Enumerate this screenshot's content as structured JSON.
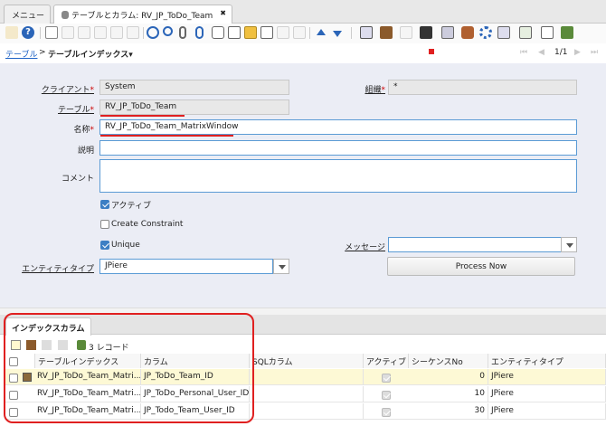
{
  "tabs": {
    "menu": "メニュー",
    "window": "テーブルとカラム: RV_JP_ToDo_Team",
    "close": "✖"
  },
  "breadcrumb": {
    "parent": "テーブル",
    "sep": ">",
    "current": "テーブルインデックス▾"
  },
  "nav": {
    "first": "⏮",
    "prev": "◀",
    "record": "1/1",
    "next": "▶",
    "last": "⏭"
  },
  "form": {
    "client_label": "クライアント",
    "client_value": "System",
    "org_label": "組織",
    "org_value": "*",
    "table_label": "テーブル",
    "table_value": "RV_JP_ToDo_Team",
    "name_label": "名称",
    "name_value": "RV_JP_ToDo_Team_MatrixWindow",
    "desc_label": "説明",
    "desc_value": "",
    "comment_label": "コメント",
    "comment_value": "",
    "active_label": "アクティブ",
    "create_constraint_label": "Create Constraint",
    "unique_label": "Unique",
    "message_label": "メッセージ",
    "message_value": "",
    "entity_label": "エンティティタイプ",
    "entity_value": "JPiere",
    "process_button": "Process Now"
  },
  "detail": {
    "tab_label": "インデックスカラム",
    "record_count": "3 レコード",
    "columns": [
      "テーブルインデックス",
      "カラム",
      "SQLカラム",
      "アクティブ",
      "シーケンスNo",
      "エンティティタイプ"
    ],
    "rows": [
      {
        "index": "RV_JP_ToDo_Team_Matri...",
        "column": "JP_ToDo_Team_ID",
        "sql": "",
        "seq": "0",
        "entity": "JPiere"
      },
      {
        "index": "RV_JP_ToDo_Team_Matri...",
        "column": "JP_ToDo_Personal_User_ID",
        "sql": "",
        "seq": "10",
        "entity": "JPiere"
      },
      {
        "index": "RV_JP_ToDo_Team_Matri...",
        "column": "JP_Todo_Team_User_ID",
        "sql": "",
        "seq": "30",
        "entity": "JPiere"
      }
    ]
  },
  "colors": {
    "accent": "#1f63c6",
    "highlight": "#e02020",
    "form_bg": "#ebedf5",
    "row_selected": "#fdf9d5"
  }
}
